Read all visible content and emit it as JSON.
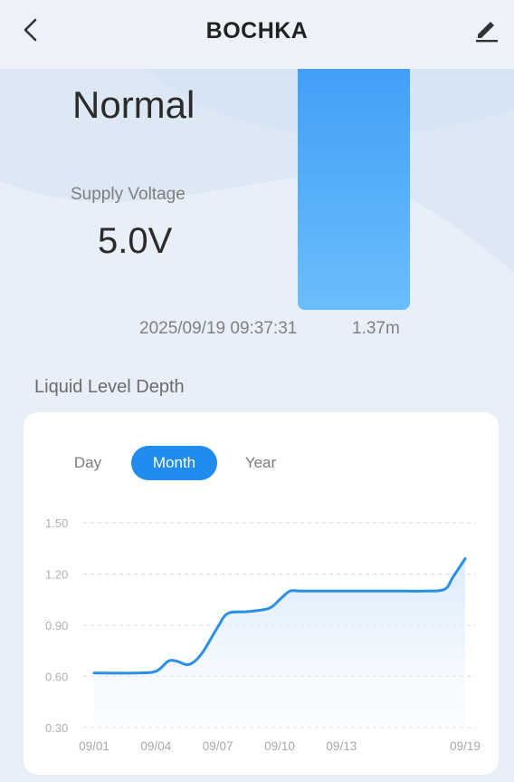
{
  "header": {
    "title": "BOCHKA",
    "back_icon": "chevron-left-icon",
    "edit_icon": "pencil-icon"
  },
  "device": {
    "status": "Normal",
    "supply_voltage_label": "Supply Voltage",
    "supply_voltage_value": "5.0V",
    "timestamp": "2025/09/19 09:37:31",
    "level": "1.37m"
  },
  "section": {
    "title": "Liquid Level Depth"
  },
  "tabs": [
    {
      "label": "Day",
      "active": false
    },
    {
      "label": "Month",
      "active": true
    },
    {
      "label": "Year",
      "active": false
    }
  ],
  "colors": {
    "accent": "#1f8cee",
    "tank": "#4aa6f8",
    "line": "#2b8fe3"
  },
  "chart_data": {
    "type": "area",
    "y_ticks": [
      "1.50",
      "1.20",
      "0.90",
      "0.60",
      "0.30"
    ],
    "ylim": [
      0.3,
      1.5
    ],
    "x_tick_labels": [
      {
        "label": "09/01",
        "day": 1
      },
      {
        "label": "09/04",
        "day": 4
      },
      {
        "label": "09/07",
        "day": 7
      },
      {
        "label": "09/10",
        "day": 10
      },
      {
        "label": "09/13",
        "day": 13
      },
      {
        "label": "09/19",
        "day": 19
      }
    ],
    "xlim": [
      1,
      19
    ],
    "grid": true,
    "series": [
      {
        "points": [
          [
            1,
            0.62
          ],
          [
            3,
            0.62
          ],
          [
            4,
            0.63
          ],
          [
            4.6,
            0.69
          ],
          [
            5,
            0.69
          ],
          [
            5.6,
            0.67
          ],
          [
            6.2,
            0.73
          ],
          [
            7,
            0.89
          ],
          [
            7.5,
            0.97
          ],
          [
            8.5,
            0.98
          ],
          [
            9.5,
            1.0
          ],
          [
            10,
            1.05
          ],
          [
            10.5,
            1.1
          ],
          [
            11,
            1.1
          ],
          [
            12,
            1.1
          ],
          [
            13,
            1.1
          ],
          [
            14,
            1.1
          ],
          [
            15,
            1.1
          ],
          [
            16,
            1.1
          ],
          [
            17,
            1.1
          ],
          [
            18,
            1.11
          ],
          [
            18.4,
            1.18
          ],
          [
            19,
            1.29
          ]
        ]
      }
    ]
  }
}
